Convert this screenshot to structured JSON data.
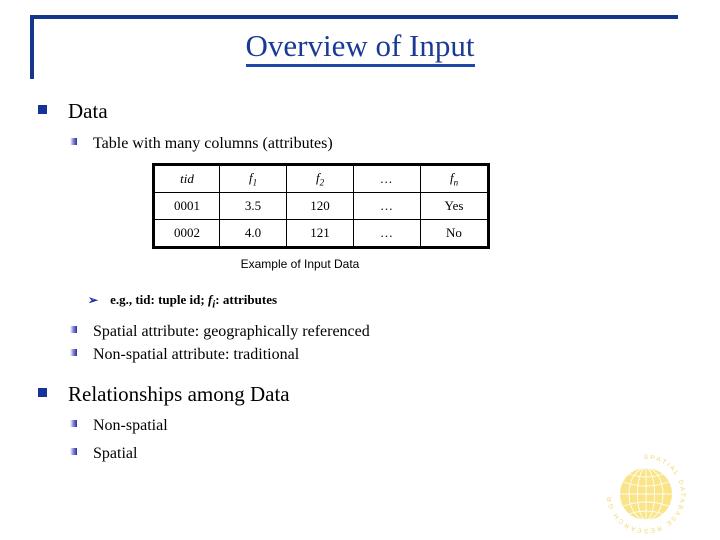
{
  "slide": {
    "title": "Overview of Input",
    "accent_color": "#1a3a94",
    "frame_color": "#14368c"
  },
  "outline": {
    "section1": {
      "label": "Data",
      "sub1": "Table with many columns (attributes)",
      "eg_prefix": "e.g., tid: tuple id; ",
      "eg_italic": "f",
      "eg_italic_sub": "i",
      "eg_suffix": ": attributes",
      "sub2": "Spatial attribute: geographically referenced",
      "sub3": "Non-spatial attribute: traditional"
    },
    "section2": {
      "label": "Relationships among Data",
      "sub1": "Non-spatial",
      "sub2": "Spatial"
    }
  },
  "table": {
    "caption": "Example of Input Data",
    "headers": [
      {
        "text": "tid",
        "sub": ""
      },
      {
        "text": "f",
        "sub": "1"
      },
      {
        "text": "f",
        "sub": "2"
      },
      {
        "text": "...",
        "sub": ""
      },
      {
        "text": "f",
        "sub": "n"
      }
    ],
    "rows": [
      [
        "0001",
        "3.5",
        "120",
        "…",
        "Yes"
      ],
      [
        "0002",
        "4.0",
        "121",
        "…",
        "No"
      ]
    ]
  },
  "logo": {
    "name": "spatial-database-research-group-logo",
    "ring_text": "SPATIAL DATABASE RESEARCH GROUP",
    "color": "#f7e27a"
  },
  "icons": {
    "bullet_square": "square-bullet-icon",
    "bullet_arrow": "➢"
  }
}
